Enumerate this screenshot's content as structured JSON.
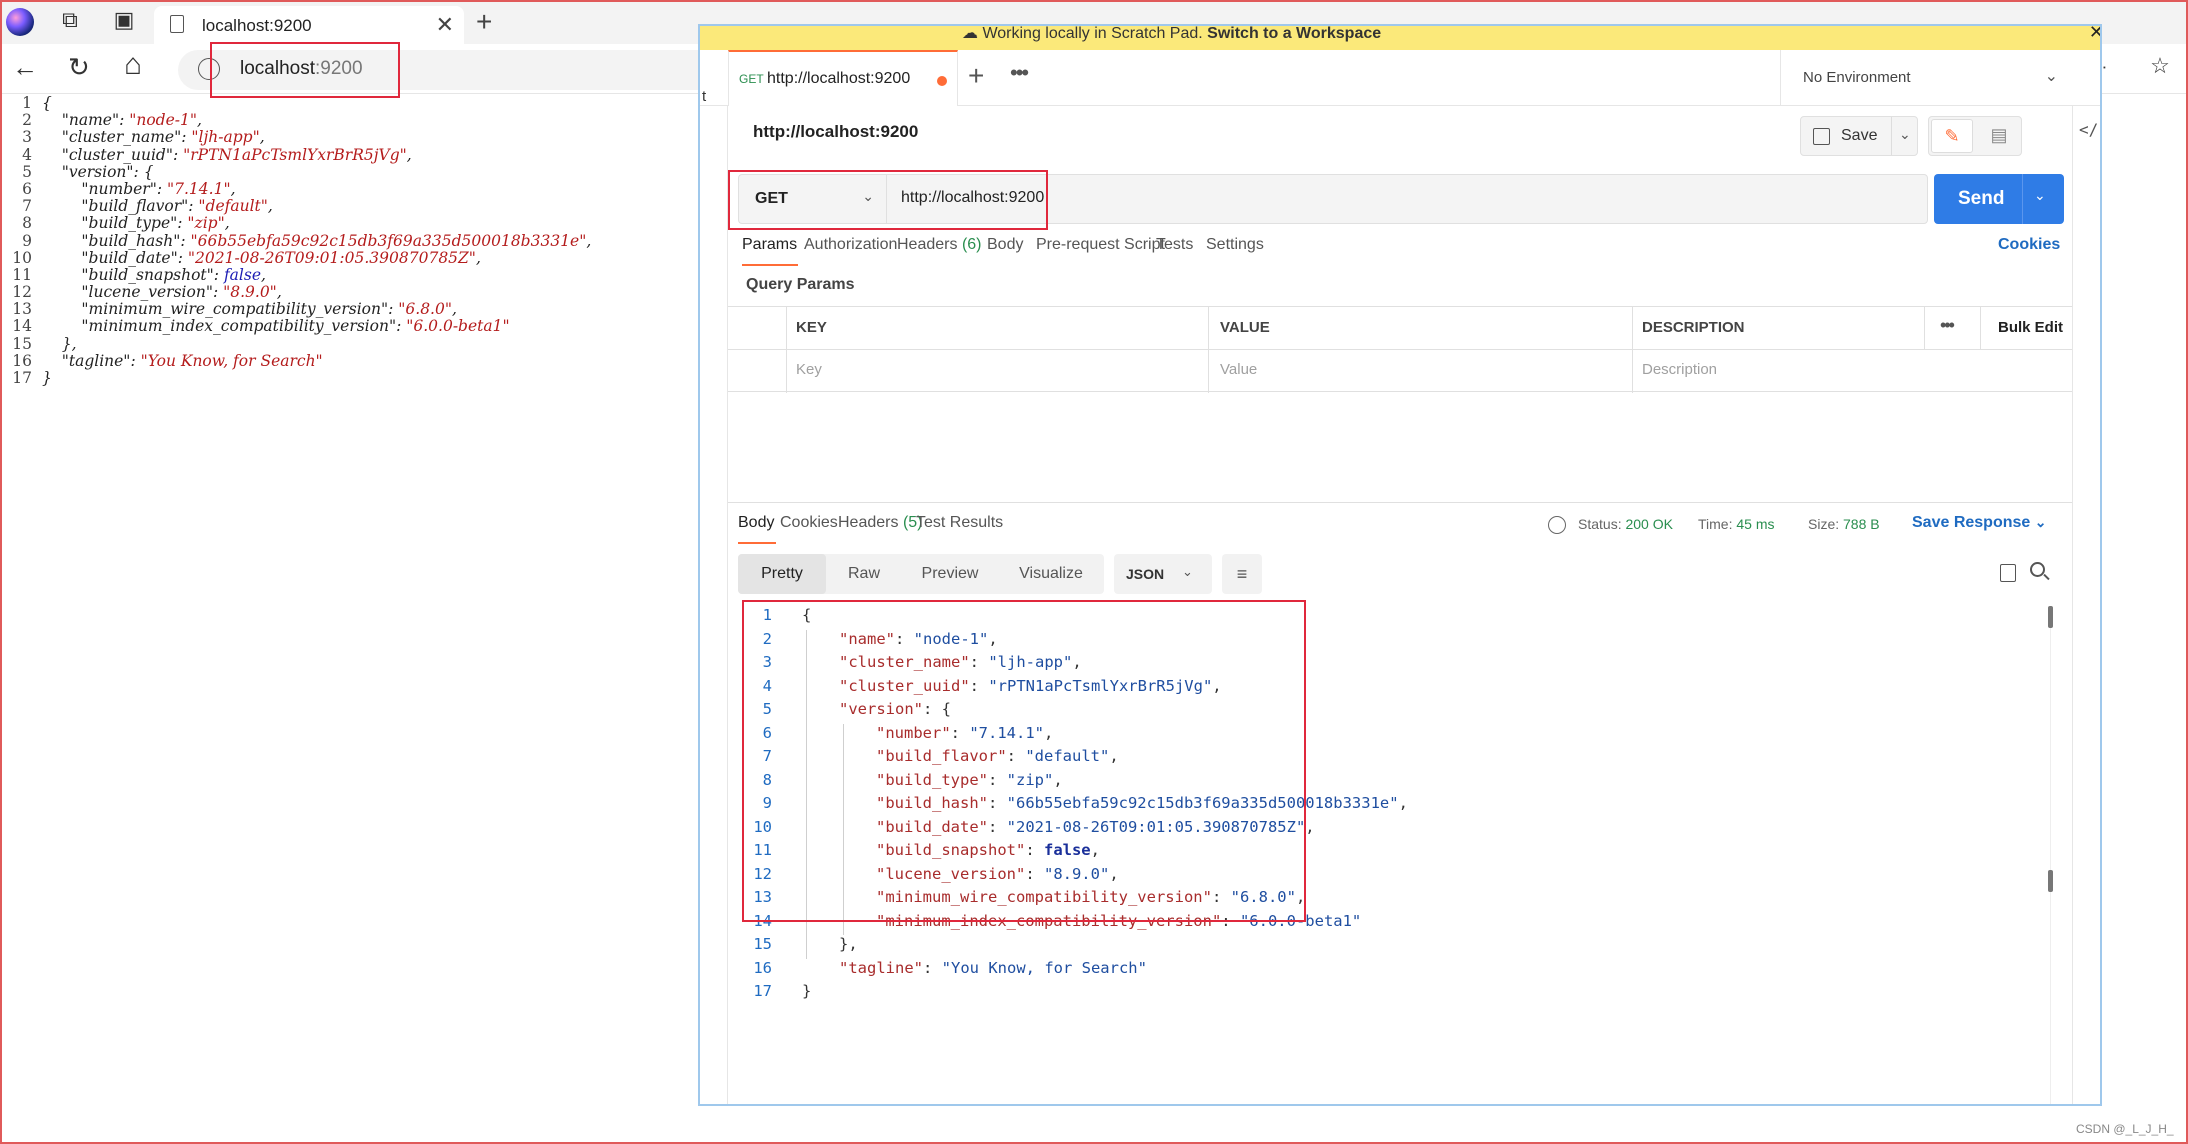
{
  "browser": {
    "tab_title": "localhost:9200",
    "tab_close": "✕",
    "new_tab": "+",
    "url_host": "localhost",
    "url_port": ":9200",
    "back_glyph": "←",
    "reload_glyph": "↻",
    "home_glyph": "⌂",
    "icons": [
      "workspaces-icon",
      "tab-actions-icon",
      "read-aloud-icon",
      "favorite-star-icon"
    ]
  },
  "raw_json": {
    "lines": [
      {
        "n": "1",
        "parts": [
          [
            "p",
            "{"
          ]
        ]
      },
      {
        "n": "2",
        "parts": [
          [
            "p",
            "    "
          ],
          [
            "k",
            "\"name\""
          ],
          [
            "p",
            ": "
          ],
          [
            "s",
            "\"node-1\""
          ],
          [
            "p",
            ","
          ]
        ]
      },
      {
        "n": "3",
        "parts": [
          [
            "p",
            "    "
          ],
          [
            "k",
            "\"cluster_name\""
          ],
          [
            "p",
            ": "
          ],
          [
            "s",
            "\"ljh-app\""
          ],
          [
            "p",
            ","
          ]
        ]
      },
      {
        "n": "4",
        "parts": [
          [
            "p",
            "    "
          ],
          [
            "k",
            "\"cluster_uuid\""
          ],
          [
            "p",
            ": "
          ],
          [
            "s",
            "\"rPTN1aPcTsmlYxrBrR5jVg\""
          ],
          [
            "p",
            ","
          ]
        ]
      },
      {
        "n": "5",
        "parts": [
          [
            "p",
            "    "
          ],
          [
            "k",
            "\"version\""
          ],
          [
            "p",
            ": {"
          ]
        ]
      },
      {
        "n": "6",
        "parts": [
          [
            "p",
            "        "
          ],
          [
            "k",
            "\"number\""
          ],
          [
            "p",
            ": "
          ],
          [
            "s",
            "\"7.14.1\""
          ],
          [
            "p",
            ","
          ]
        ]
      },
      {
        "n": "7",
        "parts": [
          [
            "p",
            "        "
          ],
          [
            "k",
            "\"build_flavor\""
          ],
          [
            "p",
            ": "
          ],
          [
            "s",
            "\"default\""
          ],
          [
            "p",
            ","
          ]
        ]
      },
      {
        "n": "8",
        "parts": [
          [
            "p",
            "        "
          ],
          [
            "k",
            "\"build_type\""
          ],
          [
            "p",
            ": "
          ],
          [
            "s",
            "\"zip\""
          ],
          [
            "p",
            ","
          ]
        ]
      },
      {
        "n": "9",
        "parts": [
          [
            "p",
            "        "
          ],
          [
            "k",
            "\"build_hash\""
          ],
          [
            "p",
            ": "
          ],
          [
            "s",
            "\"66b55ebfa59c92c15db3f69a335d500018b3331e\""
          ],
          [
            "p",
            ","
          ]
        ]
      },
      {
        "n": "10",
        "parts": [
          [
            "p",
            "        "
          ],
          [
            "k",
            "\"build_date\""
          ],
          [
            "p",
            ": "
          ],
          [
            "s",
            "\"2021-08-26T09:01:05.390870785Z\""
          ],
          [
            "p",
            ","
          ]
        ]
      },
      {
        "n": "11",
        "parts": [
          [
            "p",
            "        "
          ],
          [
            "k",
            "\"build_snapshot\""
          ],
          [
            "p",
            ": "
          ],
          [
            "b",
            "false"
          ],
          [
            "p",
            ","
          ]
        ]
      },
      {
        "n": "12",
        "parts": [
          [
            "p",
            "        "
          ],
          [
            "k",
            "\"lucene_version\""
          ],
          [
            "p",
            ": "
          ],
          [
            "s",
            "\"8.9.0\""
          ],
          [
            "p",
            ","
          ]
        ]
      },
      {
        "n": "13",
        "parts": [
          [
            "p",
            "        "
          ],
          [
            "k",
            "\"minimum_wire_compatibility_version\""
          ],
          [
            "p",
            ": "
          ],
          [
            "s",
            "\"6.8.0\""
          ],
          [
            "p",
            ","
          ]
        ]
      },
      {
        "n": "14",
        "parts": [
          [
            "p",
            "        "
          ],
          [
            "k",
            "\"minimum_index_compatibility_version\""
          ],
          [
            "p",
            ": "
          ],
          [
            "s",
            "\"6.0.0-beta1\""
          ]
        ]
      },
      {
        "n": "15",
        "parts": [
          [
            "p",
            "    },"
          ]
        ]
      },
      {
        "n": "16",
        "parts": [
          [
            "p",
            "    "
          ],
          [
            "k",
            "\"tagline\""
          ],
          [
            "p",
            ": "
          ],
          [
            "s",
            "\"You Know, for Search\""
          ]
        ]
      },
      {
        "n": "17",
        "parts": [
          [
            "p",
            "}"
          ]
        ]
      }
    ]
  },
  "postman": {
    "banner_text": "Working locally in Scratch Pad.",
    "banner_link": "Switch to a Workspace",
    "banner_close": "✕",
    "sidebar_cut": "t",
    "tab_method": "GET",
    "tab_title": "http://localhost:9200",
    "tab_plus": "+",
    "tab_more": "•••",
    "environment": "No Environment",
    "request_title": "http://localhost:9200",
    "save_label": "Save",
    "edit_glyph": "✎",
    "comment_glyph": "▤",
    "method": "GET",
    "url": "http://localhost:9200",
    "send_label": "Send",
    "request_tabs": [
      {
        "label": "Params",
        "count": ""
      },
      {
        "label": "Authorization",
        "count": ""
      },
      {
        "label": "Headers",
        "count": "(6)"
      },
      {
        "label": "Body",
        "count": ""
      },
      {
        "label": "Pre-request Script",
        "count": ""
      },
      {
        "label": "Tests",
        "count": ""
      },
      {
        "label": "Settings",
        "count": ""
      }
    ],
    "cookies_link": "Cookies",
    "query_params_title": "Query Params",
    "table_headers": {
      "key": "KEY",
      "value": "VALUE",
      "description": "DESCRIPTION",
      "more": "•••",
      "bulk_edit": "Bulk Edit"
    },
    "table_placeholders": {
      "key": "Key",
      "value": "Value",
      "description": "Description"
    },
    "response_tabs": [
      {
        "label": "Body",
        "count": ""
      },
      {
        "label": "Cookies",
        "count": ""
      },
      {
        "label": "Headers",
        "count": "(5)"
      },
      {
        "label": "Test Results",
        "count": ""
      }
    ],
    "status_label": "Status:",
    "status_value": "200 OK",
    "time_label": "Time:",
    "time_value": "45 ms",
    "size_label": "Size:",
    "size_value": "788 B",
    "save_response": "Save Response",
    "view_modes": [
      "Pretty",
      "Raw",
      "Preview",
      "Visualize"
    ],
    "format": "JSON",
    "wrap_glyph": "≡",
    "code_lines": [
      {
        "n": "1",
        "indent": 0,
        "parts": [
          [
            "p",
            "{"
          ]
        ]
      },
      {
        "n": "2",
        "indent": 1,
        "parts": [
          [
            "k",
            "\"name\""
          ],
          [
            "p",
            ": "
          ],
          [
            "s",
            "\"node-1\""
          ],
          [
            "p",
            ","
          ]
        ]
      },
      {
        "n": "3",
        "indent": 1,
        "parts": [
          [
            "k",
            "\"cluster_name\""
          ],
          [
            "p",
            ": "
          ],
          [
            "s",
            "\"ljh-app\""
          ],
          [
            "p",
            ","
          ]
        ]
      },
      {
        "n": "4",
        "indent": 1,
        "parts": [
          [
            "k",
            "\"cluster_uuid\""
          ],
          [
            "p",
            ": "
          ],
          [
            "s",
            "\"rPTN1aPcTsmlYxrBrR5jVg\""
          ],
          [
            "p",
            ","
          ]
        ]
      },
      {
        "n": "5",
        "indent": 1,
        "parts": [
          [
            "k",
            "\"version\""
          ],
          [
            "p",
            ": {"
          ]
        ]
      },
      {
        "n": "6",
        "indent": 2,
        "parts": [
          [
            "k",
            "\"number\""
          ],
          [
            "p",
            ": "
          ],
          [
            "s",
            "\"7.14.1\""
          ],
          [
            "p",
            ","
          ]
        ]
      },
      {
        "n": "7",
        "indent": 2,
        "parts": [
          [
            "k",
            "\"build_flavor\""
          ],
          [
            "p",
            ": "
          ],
          [
            "s",
            "\"default\""
          ],
          [
            "p",
            ","
          ]
        ]
      },
      {
        "n": "8",
        "indent": 2,
        "parts": [
          [
            "k",
            "\"build_type\""
          ],
          [
            "p",
            ": "
          ],
          [
            "s",
            "\"zip\""
          ],
          [
            "p",
            ","
          ]
        ]
      },
      {
        "n": "9",
        "indent": 2,
        "parts": [
          [
            "k",
            "\"build_hash\""
          ],
          [
            "p",
            ": "
          ],
          [
            "s",
            "\"66b55ebfa59c92c15db3f69a335d500018b3331e\""
          ],
          [
            "p",
            ","
          ]
        ]
      },
      {
        "n": "10",
        "indent": 2,
        "parts": [
          [
            "k",
            "\"build_date\""
          ],
          [
            "p",
            ": "
          ],
          [
            "s",
            "\"2021-08-26T09:01:05.390870785Z\""
          ],
          [
            "p",
            ","
          ]
        ]
      },
      {
        "n": "11",
        "indent": 2,
        "parts": [
          [
            "k",
            "\"build_snapshot\""
          ],
          [
            "p",
            ": "
          ],
          [
            "b",
            "false"
          ],
          [
            "p",
            ","
          ]
        ]
      },
      {
        "n": "12",
        "indent": 2,
        "parts": [
          [
            "k",
            "\"lucene_version\""
          ],
          [
            "p",
            ": "
          ],
          [
            "s",
            "\"8.9.0\""
          ],
          [
            "p",
            ","
          ]
        ]
      },
      {
        "n": "13",
        "indent": 2,
        "parts": [
          [
            "k",
            "\"minimum_wire_compatibility_version\""
          ],
          [
            "p",
            ": "
          ],
          [
            "s",
            "\"6.8.0\""
          ],
          [
            "p",
            ","
          ]
        ]
      },
      {
        "n": "14",
        "indent": 2,
        "parts": [
          [
            "k",
            "\"minimum_index_compatibility_version\""
          ],
          [
            "p",
            ": "
          ],
          [
            "s",
            "\"6.0.0-beta1\""
          ]
        ]
      },
      {
        "n": "15",
        "indent": 1,
        "parts": [
          [
            "p",
            "},"
          ]
        ]
      },
      {
        "n": "16",
        "indent": 1,
        "parts": [
          [
            "k",
            "\"tagline\""
          ],
          [
            "p",
            ": "
          ],
          [
            "s",
            "\"You Know, for Search\""
          ]
        ]
      },
      {
        "n": "17",
        "indent": 0,
        "parts": [
          [
            "p",
            "}"
          ]
        ]
      }
    ]
  },
  "watermark": "CSDN @_L_J_H_",
  "colors": {
    "accent_orange": "#ff6c37",
    "send_blue": "#2f7ce6",
    "status_green": "#2a8e4f",
    "highlight_red": "#e0283c"
  }
}
